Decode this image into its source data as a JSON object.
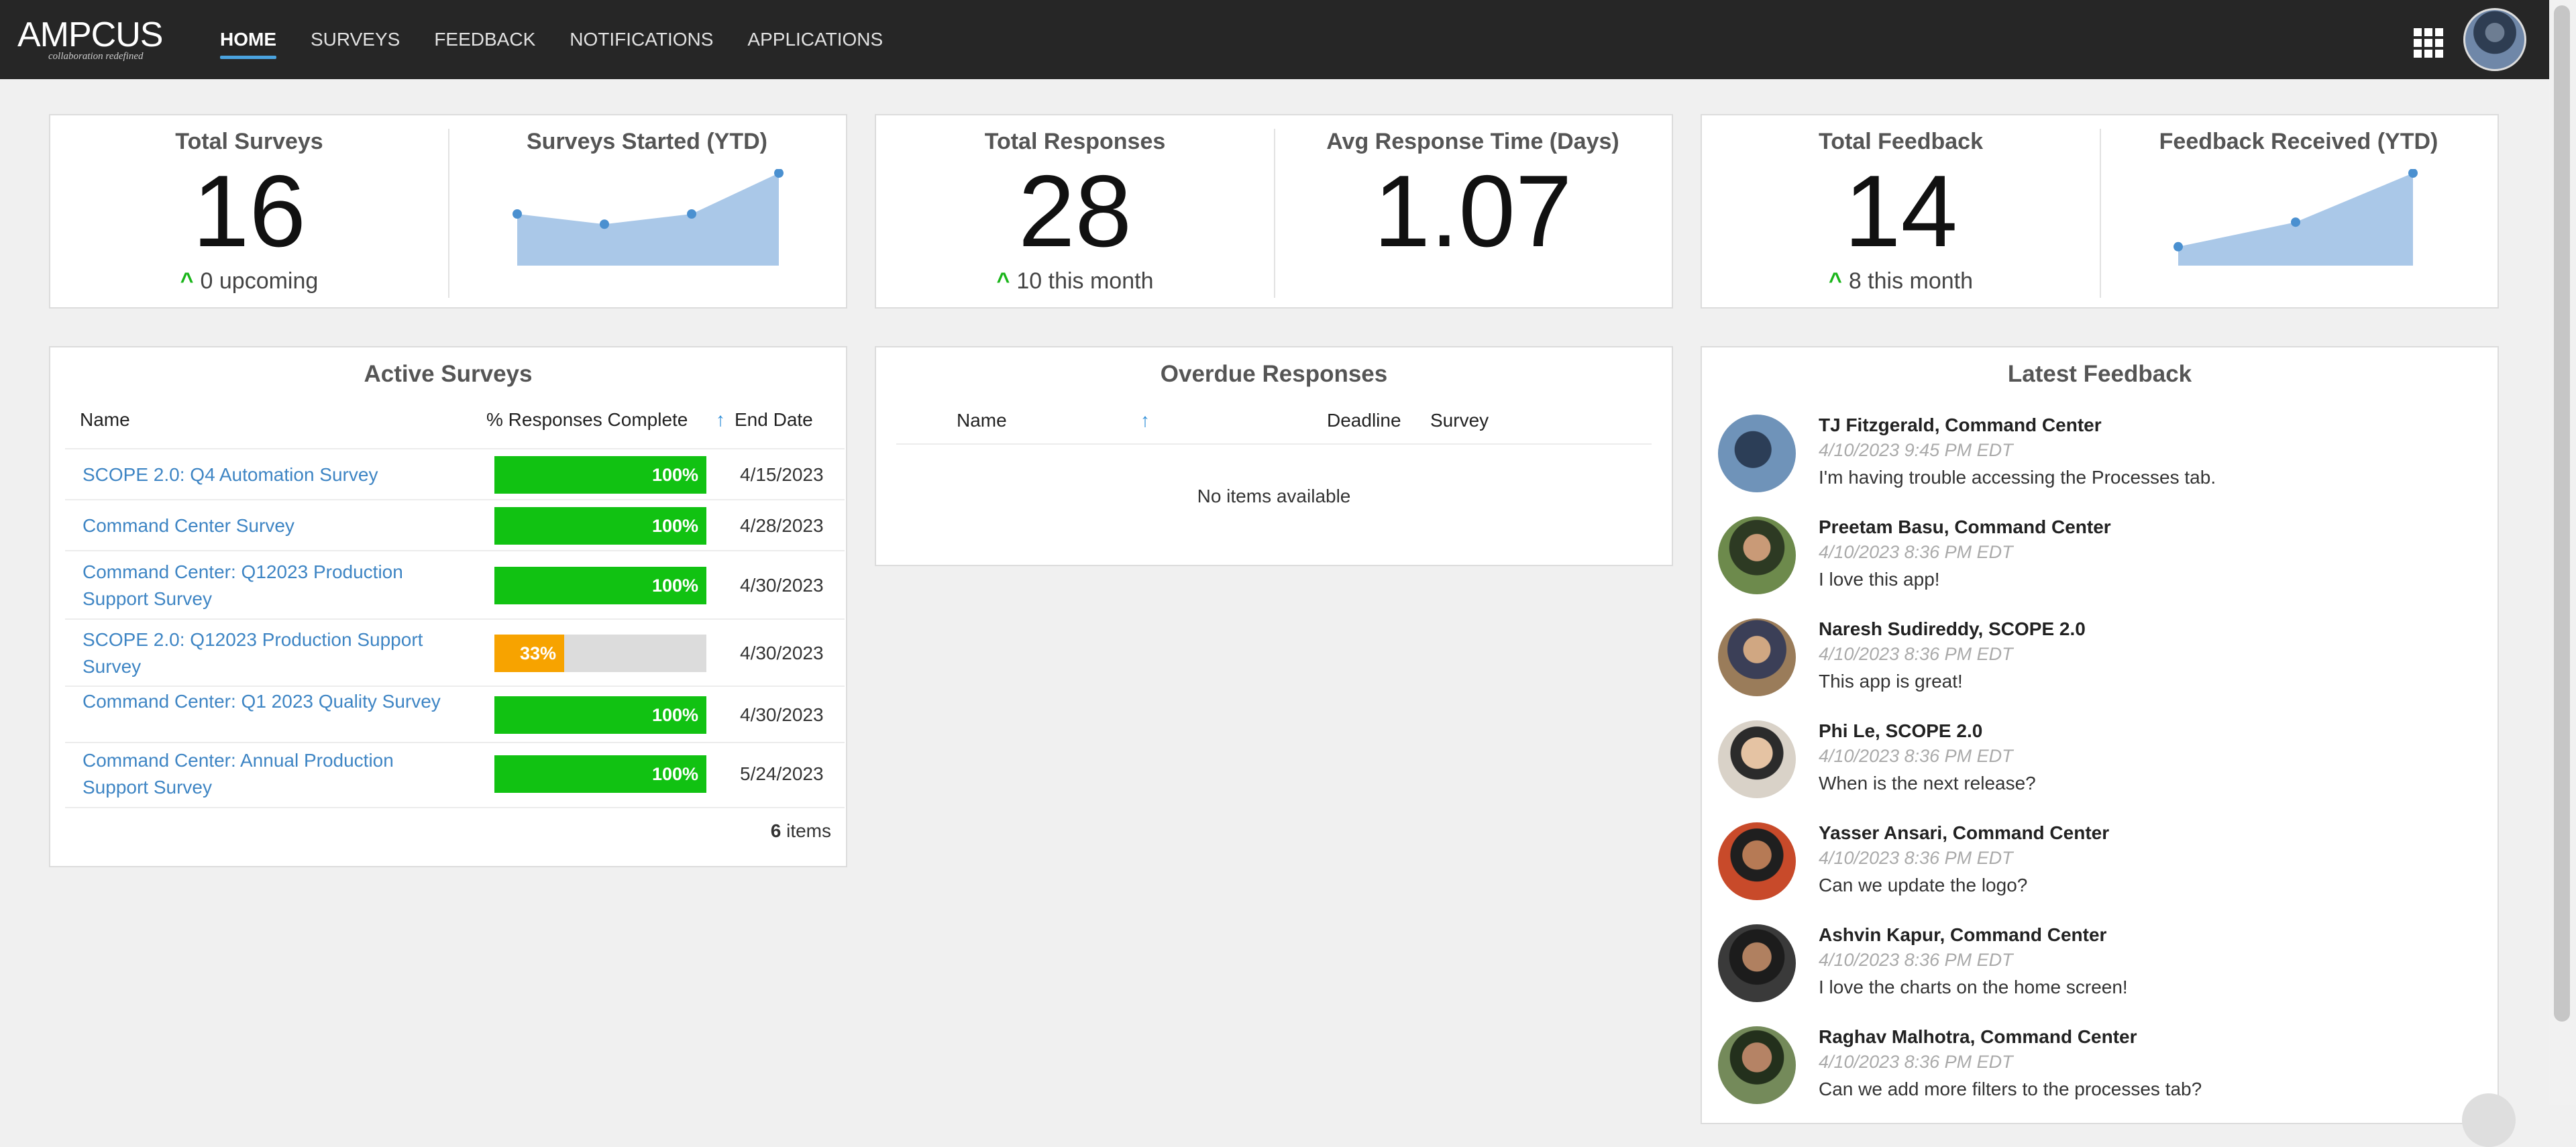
{
  "brand": {
    "logo_text": "AMPCUS",
    "tagline": "collaboration redefined"
  },
  "nav": {
    "items": [
      {
        "label": "HOME",
        "active": true
      },
      {
        "label": "SURVEYS"
      },
      {
        "label": "FEEDBACK"
      },
      {
        "label": "NOTIFICATIONS"
      },
      {
        "label": "APPLICATIONS"
      }
    ],
    "apps_icon": "grid-icon",
    "avatar": "user-avatar"
  },
  "stats": {
    "total_surveys": {
      "title": "Total Surveys",
      "value": "16",
      "sub": "0 upcoming"
    },
    "surveys_started": {
      "title": "Surveys Started (YTD)"
    },
    "total_responses": {
      "title": "Total Responses",
      "value": "28",
      "sub": "10 this month"
    },
    "avg_response": {
      "title": "Avg Response Time (Days)",
      "value": "1.07"
    },
    "total_feedback": {
      "title": "Total Feedback",
      "value": "14",
      "sub": "8 this month"
    },
    "feedback_received": {
      "title": "Feedback Received (YTD)"
    }
  },
  "active_surveys": {
    "title": "Active Surveys",
    "headers": {
      "name": "Name",
      "pct": "% Responses Complete",
      "end": "End Date"
    },
    "sort_icon": "sort-arrow-up-icon",
    "rows": [
      {
        "name": "SCOPE 2.0: Q4 Automation Survey",
        "pct": 100,
        "pct_label": "100%",
        "end": "4/15/2023"
      },
      {
        "name": "Command Center Survey",
        "pct": 100,
        "pct_label": "100%",
        "end": "4/28/2023"
      },
      {
        "name": "Command Center: Q12023 Production Support Survey",
        "pct": 100,
        "pct_label": "100%",
        "end": "4/30/2023"
      },
      {
        "name": "SCOPE 2.0: Q12023 Production Support Survey",
        "pct": 33,
        "pct_label": "33%",
        "end": "4/30/2023"
      },
      {
        "name": "Command Center: Q1 2023 Quality Survey",
        "pct": 100,
        "pct_label": "100%",
        "end": "4/30/2023"
      },
      {
        "name": "Command Center: Annual Production Support Survey",
        "pct": 100,
        "pct_label": "100%",
        "end": "5/24/2023"
      }
    ],
    "item_count": "6",
    "items_label": "items",
    "colors": {
      "complete": "#11c212",
      "partial": "#f7a300",
      "track": "#dcdcdc"
    }
  },
  "overdue": {
    "title": "Overdue Responses",
    "headers": {
      "name": "Name",
      "deadline": "Deadline",
      "survey": "Survey"
    },
    "empty": "No items available"
  },
  "latest_feedback": {
    "title": "Latest Feedback",
    "items": [
      {
        "name": "TJ Fitzgerald, Command Center",
        "time": "4/10/2023 9:45 PM EDT",
        "message": "I'm having trouble accessing the Processes tab."
      },
      {
        "name": "Preetam Basu, Command Center",
        "time": "4/10/2023 8:36 PM EDT",
        "message": "I love this app!"
      },
      {
        "name": "Naresh Sudireddy, SCOPE 2.0",
        "time": "4/10/2023 8:36 PM EDT",
        "message": "This app is great!"
      },
      {
        "name": "Phi Le, SCOPE 2.0",
        "time": "4/10/2023 8:36 PM EDT",
        "message": "When is the next release?"
      },
      {
        "name": "Yasser Ansari, Command Center",
        "time": "4/10/2023 8:36 PM EDT",
        "message": "Can we update the logo?"
      },
      {
        "name": "Ashvin Kapur, Command Center",
        "time": "4/10/2023 8:36 PM EDT",
        "message": "I love the charts on the home screen!"
      },
      {
        "name": "Raghav Malhotra, Command Center",
        "time": "4/10/2023 8:36 PM EDT",
        "message": "Can we add more filters to the processes tab?"
      }
    ]
  },
  "chart_data": [
    {
      "type": "area",
      "title": "Surveys Started (YTD)",
      "x": [
        1,
        2,
        3,
        4
      ],
      "y": [
        4,
        3,
        4,
        8
      ],
      "ylim": [
        0,
        8
      ],
      "color": "#aac8e8",
      "point_color": "#4a90d0"
    },
    {
      "type": "area",
      "title": "Feedback Received (YTD)",
      "x": [
        1,
        2,
        3
      ],
      "y": [
        1,
        4,
        10
      ],
      "ylim": [
        0,
        10
      ],
      "color": "#aac8e8",
      "point_color": "#4a90d0"
    }
  ]
}
